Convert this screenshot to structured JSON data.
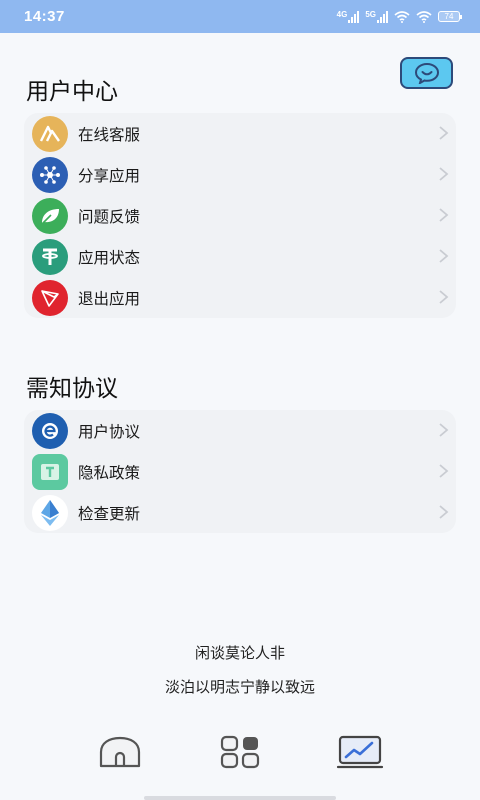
{
  "status_bar": {
    "time": "14:37",
    "net1": "4G",
    "net2": "5G",
    "battery": "74"
  },
  "user_center": {
    "title": "用户中心",
    "items": [
      {
        "label": "在线客服",
        "icon": "customer-service-icon",
        "color": "#e6b45a"
      },
      {
        "label": "分享应用",
        "icon": "share-icon",
        "color": "#2c5fb4"
      },
      {
        "label": "问题反馈",
        "icon": "leaf-icon",
        "color": "#3cae5a"
      },
      {
        "label": "应用状态",
        "icon": "tether-icon",
        "color": "#2a9d7c"
      },
      {
        "label": "退出应用",
        "icon": "tron-icon",
        "color": "#e0242e"
      }
    ]
  },
  "agreements": {
    "title": "需知协议",
    "items": [
      {
        "label": "用户协议",
        "icon": "e-icon",
        "color": "#1f5fb0"
      },
      {
        "label": "隐私政策",
        "icon": "document-icon",
        "color": "#5cc9a0"
      },
      {
        "label": "检查更新",
        "icon": "ethereum-icon",
        "color": "#5da6e6"
      }
    ]
  },
  "footer": {
    "line1": "闲谈莫论人非",
    "line2": "淡泊以明志宁静以致远"
  },
  "tabbar": {
    "items": [
      {
        "name": "home-icon"
      },
      {
        "name": "apps-grid-icon"
      },
      {
        "name": "stats-chart-icon"
      }
    ]
  }
}
